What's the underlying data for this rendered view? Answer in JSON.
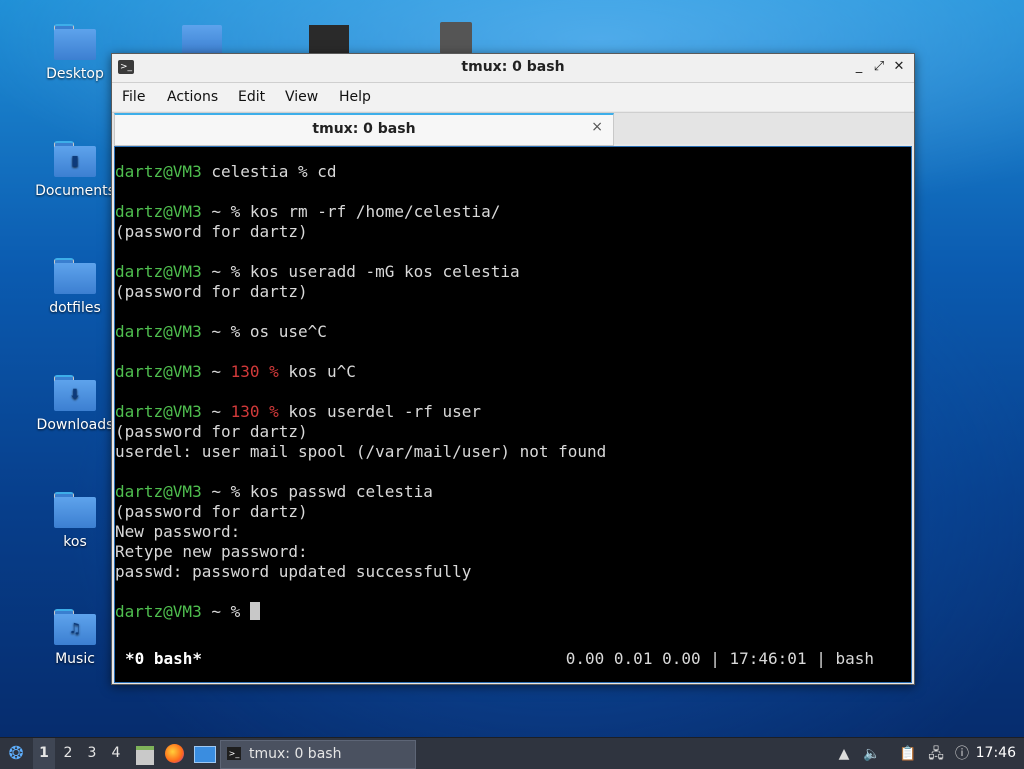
{
  "desktop": {
    "icons": [
      {
        "label": "Desktop",
        "icon": "folder-icon"
      },
      {
        "label": "Documents",
        "icon": "documents-folder-icon"
      },
      {
        "label": "dotfiles",
        "icon": "folder-icon"
      },
      {
        "label": "Downloads",
        "icon": "downloads-folder-icon"
      },
      {
        "label": "kos",
        "icon": "folder-icon"
      },
      {
        "label": "Music",
        "icon": "music-folder-icon"
      }
    ]
  },
  "window": {
    "title": "tmux: 0 bash",
    "menu": [
      "File",
      "Actions",
      "Edit",
      "View",
      "Help"
    ],
    "tab_label": "tmux: 0 bash",
    "tab_close": "×",
    "controls": {
      "minimize": "_",
      "maximize": "⤢",
      "close": "✕"
    }
  },
  "terminal": {
    "prompt_user": "dartz@VM3",
    "lines": [
      {
        "user": "dartz@VM3",
        "dir": " celestia ",
        "code": "",
        "sym": "% ",
        "cmd": "cd"
      },
      {
        "user": "dartz@VM3",
        "dir": " ~ ",
        "code": "",
        "sym": "% ",
        "cmd": "kos rm -rf /home/celestia/"
      },
      {
        "text": "(password for dartz)"
      },
      {
        "user": "dartz@VM3",
        "dir": " ~ ",
        "code": "",
        "sym": "% ",
        "cmd": "kos useradd -mG kos celestia"
      },
      {
        "text": "(password for dartz)"
      },
      {
        "user": "dartz@VM3",
        "dir": " ~ ",
        "code": "",
        "sym": "% ",
        "cmd": "os use^C"
      },
      {
        "user": "dartz@VM3",
        "dir": " ~ ",
        "code": "130 ",
        "sym": "% ",
        "cmd": "kos u^C"
      },
      {
        "user": "dartz@VM3",
        "dir": " ~ ",
        "code": "130 ",
        "sym": "% ",
        "cmd": "kos userdel -rf user"
      },
      {
        "text": "(password for dartz)"
      },
      {
        "text": "userdel: user mail spool (/var/mail/user) not found"
      },
      {
        "user": "dartz@VM3",
        "dir": " ~ ",
        "code": "",
        "sym": "% ",
        "cmd": "kos passwd celestia"
      },
      {
        "text": "(password for dartz)"
      },
      {
        "text": "New password:"
      },
      {
        "text": "Retype new password:"
      },
      {
        "text": "passwd: password updated successfully"
      },
      {
        "user": "dartz@VM3",
        "dir": " ~ ",
        "code": "",
        "sym": "% ",
        "cmd": ""
      }
    ],
    "status_left": "*0 bash*",
    "status_right": "0.00 0.01 0.00 | 17:46:01 | bash"
  },
  "taskbar": {
    "workspaces": [
      "1",
      "2",
      "3",
      "4"
    ],
    "active_workspace": "1",
    "task_label": "tmux: 0 bash",
    "clock": "17:46",
    "tray_icons": [
      "tray-up-icon",
      "volume-icon",
      "clipboard-icon",
      "network-icon",
      "update-icon"
    ]
  }
}
